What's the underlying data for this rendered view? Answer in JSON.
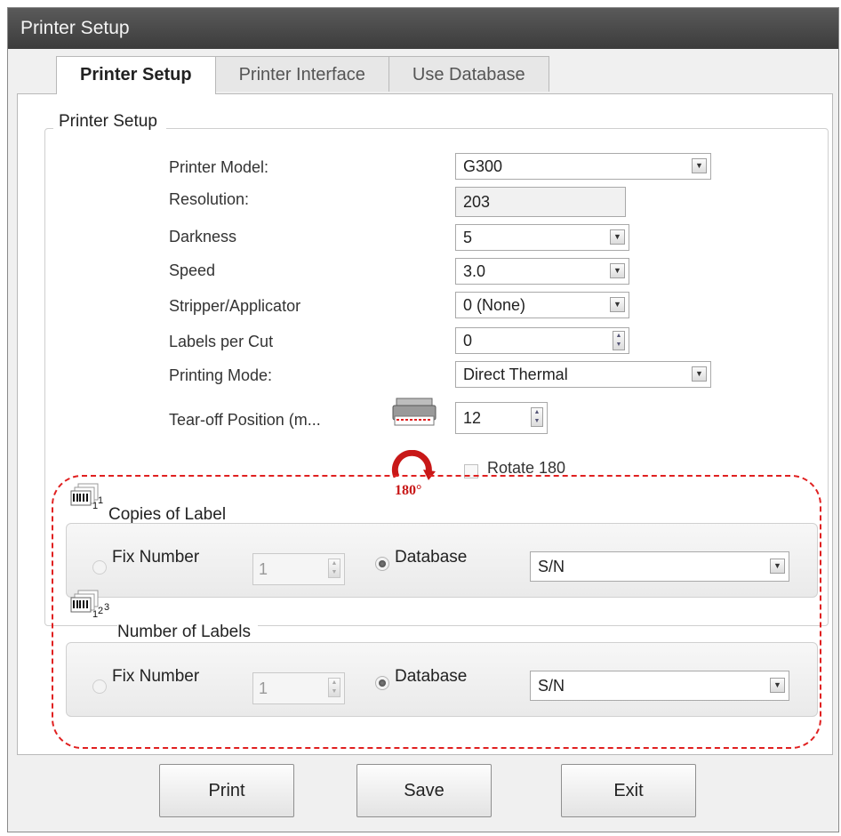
{
  "window": {
    "title": "Printer Setup"
  },
  "tabs": [
    {
      "label": "Printer Setup",
      "active": true
    },
    {
      "label": "Printer Interface",
      "active": false
    },
    {
      "label": "Use Database",
      "active": false
    }
  ],
  "group": {
    "title": "Printer Setup",
    "printer_model": {
      "label": "Printer Model:",
      "value": "G300"
    },
    "resolution": {
      "label": "Resolution:",
      "value": "203"
    },
    "darkness": {
      "label": "Darkness",
      "value": "5"
    },
    "speed": {
      "label": "Speed",
      "value": "3.0"
    },
    "stripper": {
      "label": "Stripper/Applicator",
      "value": "0 (None)"
    },
    "labels_per_cut": {
      "label": "Labels per Cut",
      "value": "0"
    },
    "printing_mode": {
      "label": "Printing Mode:",
      "value": "Direct Thermal"
    },
    "tear_off": {
      "label": "Tear-off Position  (m...",
      "value": "12"
    },
    "rotate": {
      "label": "Rotate 180",
      "checked": false,
      "icon_text": "180°"
    }
  },
  "copies": {
    "title": "Copies of Label",
    "fix_label": "Fix Number",
    "fix_value": "1",
    "database_label": "Database",
    "database_value": "S/N",
    "selected": "Database"
  },
  "number_labels": {
    "title": "Number of Labels",
    "fix_label": "Fix Number",
    "fix_value": "1",
    "database_label": "Database",
    "database_value": "S/N",
    "selected": "Database"
  },
  "buttons": {
    "print": "Print",
    "save": "Save",
    "exit": "Exit"
  },
  "colors": {
    "highlight_dash": "#e02020",
    "rotate_icon": "#c81818",
    "titlebar": "#4a4a4a"
  },
  "icons": [
    "printer-tear-icon",
    "rotate-180-icon",
    "barcode-copies-icon",
    "barcode-numbering-icon",
    "dropdown-arrow-icon",
    "spinner-icon"
  ]
}
